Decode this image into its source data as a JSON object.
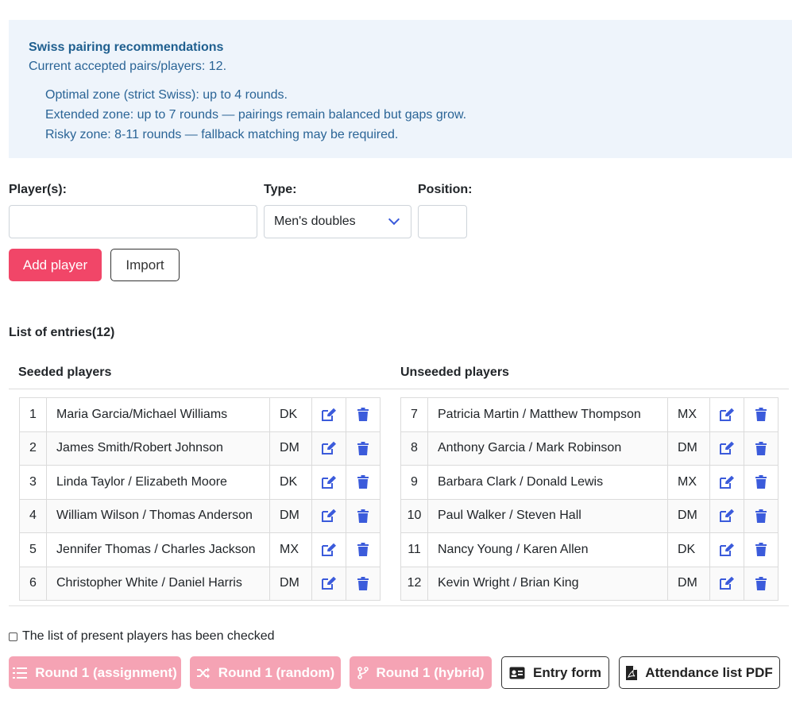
{
  "notice": {
    "title": "Swiss pairing recommendations",
    "summary": "Current accepted pairs/players: 12.",
    "zones": [
      "Optimal zone (strict Swiss): up to 4 rounds.",
      "Extended zone: up to 7 rounds — pairings remain balanced but gaps grow.",
      "Risky zone: 8-11 rounds — fallback matching may be required."
    ]
  },
  "form": {
    "players_label": "Player(s):",
    "players_value": "",
    "type_label": "Type:",
    "type_value": "Men's doubles",
    "position_label": "Position:",
    "position_value": "",
    "add_label": "Add player",
    "import_label": "Import"
  },
  "entries": {
    "title": "List of entries(12)",
    "seeded_title": "Seeded players",
    "unseeded_title": "Unseeded players",
    "seeded": [
      {
        "num": "1",
        "name": "Maria Garcia/Michael Williams",
        "code": "DK"
      },
      {
        "num": "2",
        "name": "James Smith/Robert Johnson",
        "code": "DM"
      },
      {
        "num": "3",
        "name": "Linda Taylor / Elizabeth Moore",
        "code": "DK"
      },
      {
        "num": "4",
        "name": "William Wilson / Thomas Anderson",
        "code": "DM"
      },
      {
        "num": "5",
        "name": "Jennifer Thomas / Charles Jackson",
        "code": "MX"
      },
      {
        "num": "6",
        "name": "Christopher White / Daniel Harris",
        "code": "DM"
      }
    ],
    "unseeded": [
      {
        "num": "7",
        "name": "Patricia Martin / Matthew Thompson",
        "code": "MX"
      },
      {
        "num": "8",
        "name": "Anthony Garcia / Mark Robinson",
        "code": "DM"
      },
      {
        "num": "9",
        "name": "Barbara Clark / Donald Lewis",
        "code": "MX"
      },
      {
        "num": "10",
        "name": "Paul Walker / Steven Hall",
        "code": "DM"
      },
      {
        "num": "11",
        "name": "Nancy Young / Karen Allen",
        "code": "DK"
      },
      {
        "num": "12",
        "name": "Kevin Wright / Brian King",
        "code": "DM"
      }
    ]
  },
  "checked_label": "The list of present players has been checked",
  "actions": {
    "round_assignment": "Round 1 (assignment)",
    "round_random": "Round 1 (random)",
    "round_hybrid": "Round 1 (hybrid)",
    "entry_form": "Entry form",
    "attendance_pdf": "Attendance list PDF"
  },
  "colors": {
    "accent": "#f14668",
    "accent_disabled": "#f5a3b4",
    "icon_blue": "#3b5bdb",
    "notice_bg": "#eef4fb",
    "notice_text": "#2a6496"
  }
}
